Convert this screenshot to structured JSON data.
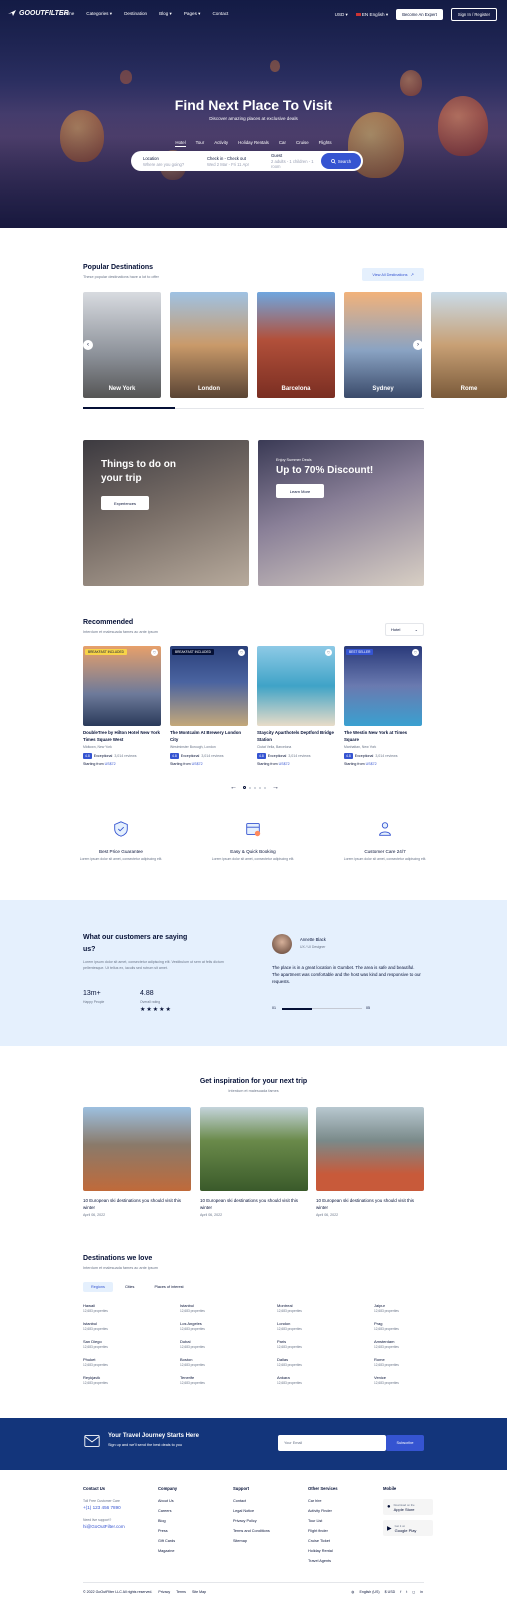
{
  "brand": {
    "name": "GOOUTFILTER"
  },
  "nav": {
    "links": [
      "Home",
      "Categories",
      "Destination",
      "Blog",
      "Pages",
      "Contact"
    ],
    "currency": "USD",
    "language": "EN English",
    "become_expert": "Become An Expert",
    "signin": "Sign In / Register"
  },
  "hero": {
    "title": "Find Next Place To Visit",
    "subtitle": "Discover amazing places at exclusive deals",
    "tabs": [
      "Hotel",
      "Tour",
      "Activity",
      "Holiday Rentals",
      "Car",
      "Cruise",
      "Flights"
    ],
    "search": {
      "location_label": "Location",
      "location_placeholder": "Where are you going?",
      "dates_label": "Check in - Check out",
      "dates_value": "Wed 2 Mar - Fri 11 Apr",
      "guest_label": "Guest",
      "guest_value": "2 adults - 1 children - 1 room",
      "button": "Search"
    }
  },
  "popular": {
    "title": "Popular Destinations",
    "subtitle": "These popular destinations have a lot to offer",
    "view_all": "View All Destinations",
    "cities": [
      "New York",
      "London",
      "Barcelona",
      "Sydney",
      "Rome"
    ]
  },
  "promos": {
    "left": {
      "title": "Things to do on your trip",
      "button": "Experiences"
    },
    "right": {
      "tag": "Enjoy Summer Deals",
      "title": "Up to 70% Discount!",
      "button": "Learn More"
    }
  },
  "recommended": {
    "title": "Recommended",
    "subtitle": "Interdum et malesuada fames ac ante ipsum",
    "filter": "Hotel",
    "cards": [
      {
        "badge": "BREAKFAST INCLUDED",
        "title": "DoubleTree by Hilton Hotel New York Times Square West",
        "loc": "Midtown, New York",
        "score": "4.8",
        "rating": "Exceptional",
        "reviews": "3,014 reviews",
        "price_label": "Starting from",
        "price": "US$72"
      },
      {
        "badge": "BREAKFAST INCLUDED",
        "title": "The Montcalm At Brewery London City",
        "loc": "Westminster Borough, London",
        "score": "4.8",
        "rating": "Exceptional",
        "reviews": "3,014 reviews",
        "price_label": "Starting from",
        "price": "US$72"
      },
      {
        "badge": "",
        "title": "Staycity Aparthotels Deptford Bridge Station",
        "loc": "Ciutat Vella, Barcelona",
        "score": "4.8",
        "rating": "Exceptional",
        "reviews": "3,014 reviews",
        "price_label": "Starting from",
        "price": "US$72"
      },
      {
        "badge": "BEST SELLER",
        "title": "The Westin New York at Times Square",
        "loc": "Manhattan, New York",
        "score": "4.8",
        "rating": "Exceptional",
        "reviews": "3,014 reviews",
        "price_label": "Starting from",
        "price": "US$72"
      }
    ]
  },
  "features": [
    {
      "title": "Best Price Guarantee",
      "desc": "Lorem ipsum dolor sit amet, consectetur adipiscing elit."
    },
    {
      "title": "Easy & Quick Booking",
      "desc": "Lorem ipsum dolor sit amet, consectetur adipiscing elit."
    },
    {
      "title": "Customer Care 24/7",
      "desc": "Lorem ipsum dolor sit amet, consectetur adipiscing elit."
    }
  ],
  "testimonials": {
    "title": "What our customers are saying us?",
    "desc": "Lorem ipsum dolor sit amet, consectetur adipiscing elit. Vestibulum ut sem at felis dictum pellentesque. Ut tellus ex, iaculis sed rutrum sit amet.",
    "stat1_value": "13m+",
    "stat1_label": "Happy People",
    "stat2_value": "4.88",
    "stat2_label": "Overall rating",
    "stars": "★★★★★",
    "name": "Annette Black",
    "role": "UX / UI Designer",
    "quote": "The place is in a great location in Gumbet. The area is safe and beautiful. The apartment was comfortable and the host was kind and responsive to our requests.",
    "page_start": "01",
    "page_end": "05"
  },
  "inspiration": {
    "title": "Get inspiration for your next trip",
    "subtitle": "Interdum et malesuada fames",
    "posts": [
      {
        "title": "10 European ski destinations you should visit this winter",
        "date": "April 06, 2022"
      },
      {
        "title": "10 European ski destinations you should visit this winter",
        "date": "April 06, 2022"
      },
      {
        "title": "10 European ski destinations you should visit this winter",
        "date": "April 06, 2022"
      }
    ]
  },
  "destlove": {
    "title": "Destinations we love",
    "subtitle": "Interdum et malesuada fames ac ante ipsum",
    "tabs": [
      "Regions",
      "Cities",
      "Places of interest"
    ],
    "cols": [
      [
        {
          "n": "Hawaii",
          "p": "12,683 properties"
        },
        {
          "n": "Istanbul",
          "p": "12,683 properties"
        },
        {
          "n": "San Diego",
          "p": "12,683 properties"
        },
        {
          "n": "Phuket",
          "p": "12,683 properties"
        },
        {
          "n": "Reykjavik",
          "p": "12,683 properties"
        }
      ],
      [
        {
          "n": "Istanbul",
          "p": "12,683 properties"
        },
        {
          "n": "Los Angeles",
          "p": "12,683 properties"
        },
        {
          "n": "Dubai",
          "p": "12,683 properties"
        },
        {
          "n": "Boston",
          "p": "12,683 properties"
        },
        {
          "n": "Tenerife",
          "p": "12,683 properties"
        }
      ],
      [
        {
          "n": "Montreal",
          "p": "12,683 properties"
        },
        {
          "n": "London",
          "p": "12,683 properties"
        },
        {
          "n": "Paris",
          "p": "12,683 properties"
        },
        {
          "n": "Dallas",
          "p": "12,683 properties"
        },
        {
          "n": "Ankara",
          "p": "12,683 properties"
        }
      ],
      [
        {
          "n": "Jaipur",
          "p": "12,683 properties"
        },
        {
          "n": "Prag",
          "p": "12,683 properties"
        },
        {
          "n": "Amsterdam",
          "p": "12,683 properties"
        },
        {
          "n": "Rome",
          "p": "12,683 properties"
        },
        {
          "n": "Venice",
          "p": "12,683 properties"
        }
      ]
    ]
  },
  "newsletter": {
    "title": "Your Travel Journey Starts Here",
    "subtitle": "Sign up and we'll send the best deals to you",
    "placeholder": "Your Email",
    "button": "Subscribe"
  },
  "footer": {
    "contact": {
      "h": "Contact Us",
      "l1": "Toll Free Customer Care",
      "phone": "+(1) 123 456 7890",
      "l2": "Need live support?",
      "email": "hi@GoOutFilter.com"
    },
    "company": {
      "h": "Company",
      "items": [
        "About Us",
        "Careers",
        "Blog",
        "Press",
        "Gift Cards",
        "Magazine"
      ]
    },
    "support": {
      "h": "Support",
      "items": [
        "Contact",
        "Legal Notice",
        "Privacy Policy",
        "Terms and Conditions",
        "Sitemap"
      ]
    },
    "services": {
      "h": "Other Services",
      "items": [
        "Car hire",
        "Activity Finder",
        "Tour List",
        "Flight finder",
        "Cruise Ticket",
        "Holiday Rental",
        "Travel Agents"
      ]
    },
    "mobile": {
      "h": "Mobile",
      "apple_small": "Download on the",
      "apple": "Apple Store",
      "google_small": "Get it on",
      "google": "Google Play"
    },
    "copyright": "© 2022 GoOutFilter LLC All rights reserved.",
    "links": [
      "Privacy",
      "Terms",
      "Site Map"
    ],
    "lang": "English (US)",
    "currency": "$ USD"
  }
}
